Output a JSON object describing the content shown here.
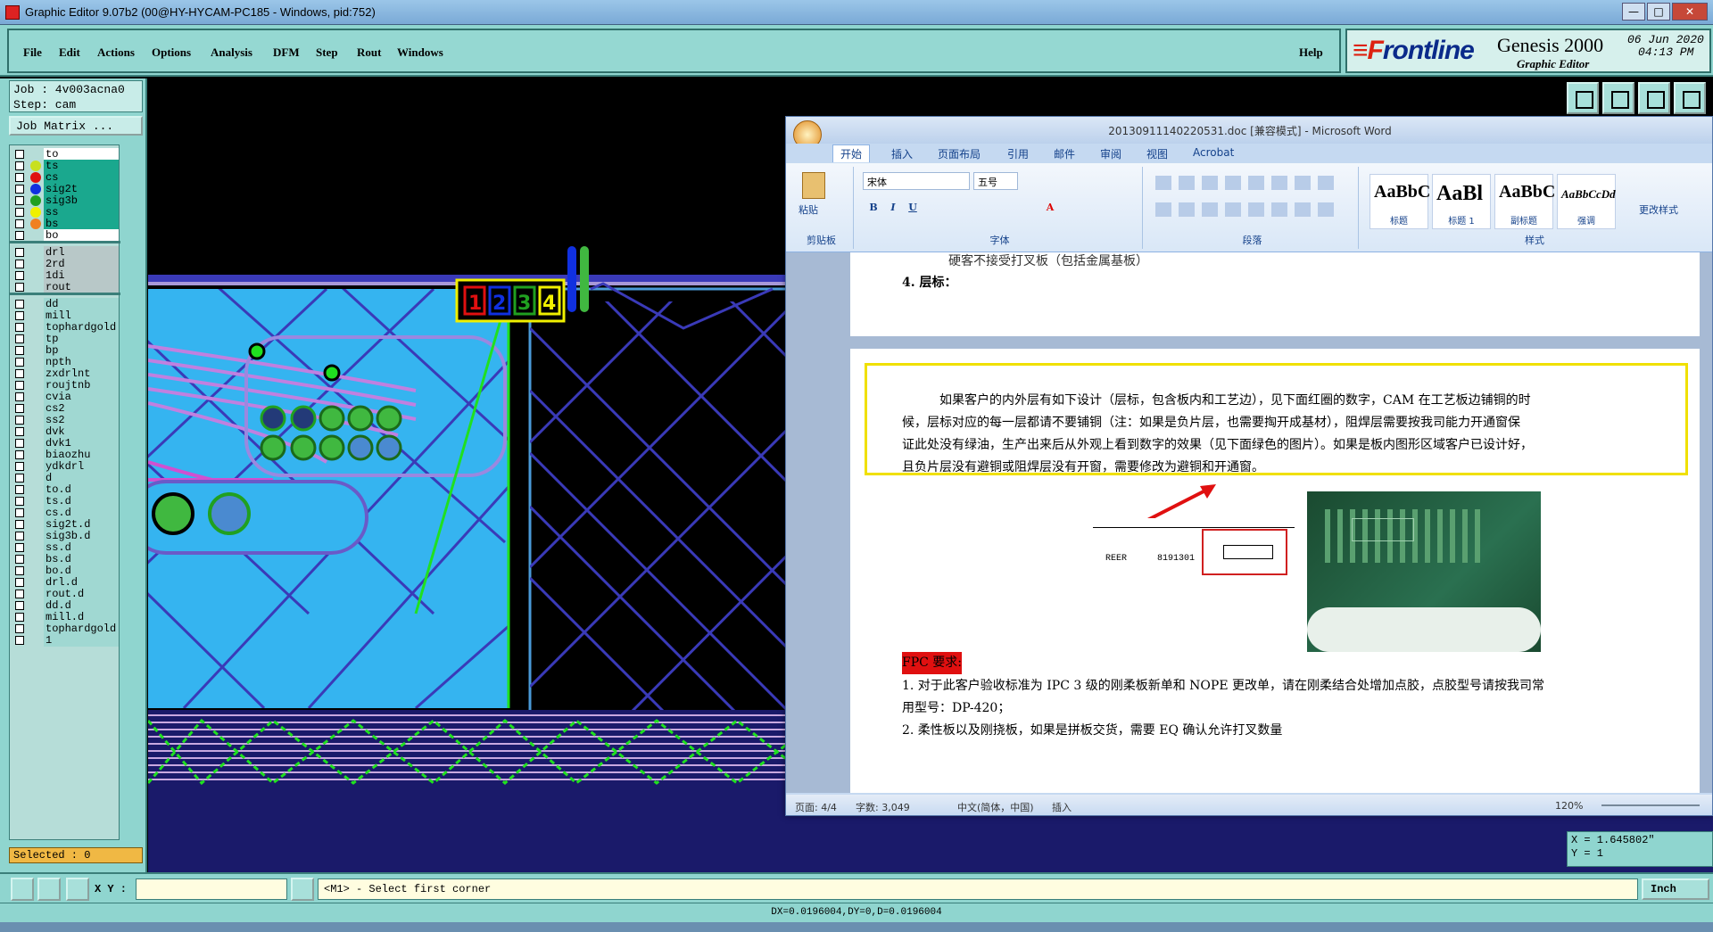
{
  "titlebar": {
    "title": "Graphic Editor 9.07b2 (00@HY-HYCAM-PC185 - Windows, pid:752)",
    "min": "—",
    "max": "□",
    "close": "✕"
  },
  "menu": {
    "items": [
      "File",
      "Edit",
      "Actions",
      "Options",
      "Analysis",
      "DFM",
      "Step",
      "Rout",
      "Windows"
    ],
    "help": "Help"
  },
  "brand": {
    "logo_f": "≡F",
    "logo_rest": "rontline",
    "product": "Genesis 2000",
    "date": "06 Jun 2020",
    "time": "04:13 PM",
    "subtitle": "Graphic Editor"
  },
  "job": {
    "job_label": "Job : 4v003acna0",
    "step_label": "Step: cam",
    "matrix_button": "Job Matrix ..."
  },
  "layers": [
    {
      "name": "to",
      "color": "#ffffff",
      "dot": ""
    },
    {
      "name": "ts",
      "color": "#1aa88e",
      "dot": "#c8e020"
    },
    {
      "name": "cs",
      "color": "#1aa88e",
      "dot": "#e01010"
    },
    {
      "name": "sig2t",
      "color": "#1aa88e",
      "dot": "#1030e0"
    },
    {
      "name": "sig3b",
      "color": "#1aa88e",
      "dot": "#20a020"
    },
    {
      "name": "ss",
      "color": "#1aa88e",
      "dot": "#f0f000"
    },
    {
      "name": "bs",
      "color": "#1aa88e",
      "dot": "#f08020"
    },
    {
      "name": "bo",
      "color": "#ffffff",
      "dot": ""
    },
    {
      "name": "drl",
      "color": "#b8c8c8",
      "dot": ""
    },
    {
      "name": "2rd",
      "color": "#b8c8c8",
      "dot": ""
    },
    {
      "name": "1di",
      "color": "#b8c8c8",
      "dot": ""
    },
    {
      "name": "rout",
      "color": "#b8c8c8",
      "dot": ""
    },
    {
      "name": "dd",
      "color": "#a0d8d2",
      "dot": ""
    },
    {
      "name": "mill",
      "color": "#a0d8d2",
      "dot": ""
    },
    {
      "name": "tophardgold",
      "color": "#a0d8d2",
      "dot": ""
    },
    {
      "name": "tp",
      "color": "#a0d8d2",
      "dot": ""
    },
    {
      "name": "bp",
      "color": "#a0d8d2",
      "dot": ""
    },
    {
      "name": "npth",
      "color": "#a0d8d2",
      "dot": ""
    },
    {
      "name": "zxdrlnt",
      "color": "#a0d8d2",
      "dot": ""
    },
    {
      "name": "roujtnb",
      "color": "#a0d8d2",
      "dot": ""
    },
    {
      "name": "cvia",
      "color": "#a0d8d2",
      "dot": ""
    },
    {
      "name": "cs2",
      "color": "#a0d8d2",
      "dot": ""
    },
    {
      "name": "ss2",
      "color": "#a0d8d2",
      "dot": ""
    },
    {
      "name": "dvk",
      "color": "#a0d8d2",
      "dot": ""
    },
    {
      "name": "dvk1",
      "color": "#a0d8d2",
      "dot": ""
    },
    {
      "name": "biaozhu",
      "color": "#a0d8d2",
      "dot": ""
    },
    {
      "name": "ydkdrl",
      "color": "#a0d8d2",
      "dot": ""
    },
    {
      "name": "d",
      "color": "#a0d8d2",
      "dot": ""
    },
    {
      "name": "to.d",
      "color": "#a0d8d2",
      "dot": ""
    },
    {
      "name": "ts.d",
      "color": "#a0d8d2",
      "dot": ""
    },
    {
      "name": "cs.d",
      "color": "#a0d8d2",
      "dot": ""
    },
    {
      "name": "sig2t.d",
      "color": "#a0d8d2",
      "dot": ""
    },
    {
      "name": "sig3b.d",
      "color": "#a0d8d2",
      "dot": ""
    },
    {
      "name": "ss.d",
      "color": "#a0d8d2",
      "dot": ""
    },
    {
      "name": "bs.d",
      "color": "#a0d8d2",
      "dot": ""
    },
    {
      "name": "bo.d",
      "color": "#a0d8d2",
      "dot": ""
    },
    {
      "name": "drl.d",
      "color": "#a0d8d2",
      "dot": ""
    },
    {
      "name": "rout.d",
      "color": "#a0d8d2",
      "dot": ""
    },
    {
      "name": "dd.d",
      "color": "#a0d8d2",
      "dot": ""
    },
    {
      "name": "mill.d",
      "color": "#a0d8d2",
      "dot": ""
    },
    {
      "name": "tophardgold",
      "color": "#a0d8d2",
      "dot": ""
    },
    {
      "name": "1",
      "color": "#a0d8d2",
      "dot": ""
    }
  ],
  "selected": "Selected : 0",
  "coords": {
    "x": "X = 1.645802\"",
    "y": "Y = 1"
  },
  "cmd": {
    "xy_label": "X Y :",
    "input_value": "",
    "message": "<M1> - Select first corner",
    "unit": "Inch"
  },
  "status": "DX=0.0196004,DY=0,D=0.0196004",
  "word": {
    "title": "20130911140220531.doc [兼容模式] - Microsoft Word",
    "tabs": [
      "开始",
      "插入",
      "页面布局",
      "引用",
      "邮件",
      "审阅",
      "视图",
      "Acrobat"
    ],
    "font_name": "宋体",
    "font_size": "五号",
    "paste": "粘贴",
    "groups": [
      "剪贴板",
      "字体",
      "段落",
      "样式"
    ],
    "styles": [
      {
        "sample": "AaBbC",
        "label": "标题"
      },
      {
        "sample": "AaBl",
        "label": "标题 1"
      },
      {
        "sample": "AaBbC",
        "label": "副标题"
      },
      {
        "sample": "AaBbCcDd",
        "label": "强调"
      }
    ],
    "change_styles": "更改样式",
    "page1_line1": "硬客不接受打叉板（包括金属基板）",
    "page1_line2": "4. 层标：",
    "para": [
      "如果客户的内外层有如下设计（层标，包含板内和工艺边），见下面红圈的数字，CAM 在工艺板边铺铜的时",
      "候，层标对应的每一层都请不要铺铜（注：如果是负片层，也需要掏开成基材），阻焊层需要按我司能力开通窗保",
      "证此处没有绿油，生产出来后从外观上看到数字的效果（见下面绿色的图片）。如果是板内图形区域客户已设计好，",
      "且负片层没有避铜或阻焊层没有开窗，需要修改为避铜和开通窗。"
    ],
    "img_text1": "REER",
    "img_text2": "8191301",
    "fpc_title": "FPC 要求:",
    "fpc_lines": [
      "1. 对于此客户验收标准为 IPC 3 级的刚柔板新单和 NOPE 更改单，请在刚柔结合处增加点胶，点胶型号请按我司常",
      "用型号：DP-420；",
      "2. 柔性板以及刚挠板，如果是拼板交货，需要 EQ 确认允许打叉数量"
    ],
    "status": {
      "page": "页面: 4/4",
      "words": "字数: 3,049",
      "lang": "中文(简体，中国)",
      "mode": "插入",
      "zoom": "120%"
    }
  },
  "colors": {
    "panel": "#8fd5cf",
    "border": "#3b7f7a",
    "pcb_bg": "#35b4f0",
    "trace": "#3a3ab8",
    "green": "#20e020"
  }
}
